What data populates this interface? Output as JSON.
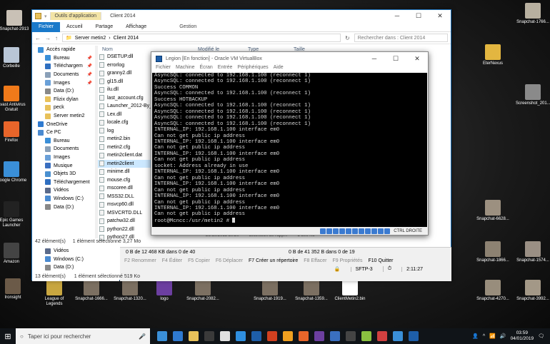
{
  "desktop": {
    "icons_left": [
      {
        "label": "Snapchat-2913",
        "color": "#c9c1b6"
      },
      {
        "label": "Corbeille",
        "color": "#b9c6d6"
      },
      {
        "label": "Avast Antivirus Gratuit",
        "color": "#f07a1a"
      },
      {
        "label": "Firefox",
        "color": "#e8652a"
      },
      {
        "label": "Google Chrome",
        "color": "#3a8fd8"
      },
      {
        "label": "Epic Games Launcher",
        "color": "#222222"
      },
      {
        "label": "Amazon",
        "color": "#444444"
      },
      {
        "label": "Ironsight",
        "color": "#6b5a48"
      }
    ],
    "icons_right": [
      {
        "label": "Snapchat-1766...",
        "color": "#b8b0a0"
      },
      {
        "label": "EterNexus",
        "color": "#e3b640"
      },
      {
        "label": "Screenshot_201...",
        "color": "#8a8a8a"
      },
      {
        "label": "Snapchat-6628...",
        "color": "#9c9080"
      },
      {
        "label": "Snapchat-1574...",
        "color": "#9a8f84"
      },
      {
        "label": "Snapchat-1866...",
        "color": "#8d8272"
      },
      {
        "label": "Snapchat-3992...",
        "color": "#a39887"
      },
      {
        "label": "Snapchat-4270...",
        "color": "#988d7c"
      }
    ],
    "icons_bottom": [
      {
        "label": "League of Legends",
        "color": "#c8a640"
      },
      {
        "label": "Snapchat-1666...",
        "color": "#7c7062"
      },
      {
        "label": "Snapchat-1320...",
        "color": "#7c7062"
      },
      {
        "label": "logo",
        "color": "#6c3fa0"
      },
      {
        "label": "Snapchat-2082...",
        "color": "#7c7062"
      },
      {
        "label": "Snapchat-1919...",
        "color": "#7c7062"
      },
      {
        "label": "Snapchat-1359...",
        "color": "#7c7062"
      },
      {
        "label": "ClientMetin2.bin",
        "color": "#ffffff"
      }
    ]
  },
  "explorer": {
    "quick_access": "▾",
    "context_tab": "Outils d'application",
    "title_path": "Client 2014",
    "ribbon": [
      "Fichier",
      "Accueil",
      "Partage",
      "Affichage"
    ],
    "ribbon_context": "Gestion",
    "address": [
      "Server metin2",
      "Client 2014"
    ],
    "search_placeholder": "Rechercher dans : Client 2014",
    "columns": {
      "name": "Nom",
      "modified": "Modifié le",
      "type": "Type",
      "size": "Taille"
    },
    "nav": [
      {
        "label": "Accès rapide",
        "color": "#3a8fd8",
        "indent": false,
        "pin": ""
      },
      {
        "label": "Bureau",
        "color": "#3a8fd8",
        "indent": true,
        "pin": "📌"
      },
      {
        "label": "Téléchargem",
        "color": "#2f6fc0",
        "indent": true,
        "pin": "📌"
      },
      {
        "label": "Documents",
        "color": "#8aa0b8",
        "indent": true,
        "pin": "📌"
      },
      {
        "label": "Images",
        "color": "#6aa0d8",
        "indent": true,
        "pin": "📌"
      },
      {
        "label": "Data (D:)",
        "color": "#888888",
        "indent": true,
        "pin": ""
      },
      {
        "label": "Flizix dylan",
        "color": "#e8c15a",
        "indent": true,
        "pin": ""
      },
      {
        "label": "peck",
        "color": "#e8c15a",
        "indent": true,
        "pin": ""
      },
      {
        "label": "Server metin2",
        "color": "#e8c15a",
        "indent": true,
        "pin": ""
      },
      {
        "label": "OneDrive",
        "color": "#2f7ad0",
        "indent": false,
        "pin": ""
      },
      {
        "label": "Ce PC",
        "color": "#4a8ad0",
        "indent": false,
        "pin": ""
      },
      {
        "label": "Bureau",
        "color": "#3a8fd8",
        "indent": true,
        "pin": ""
      },
      {
        "label": "Documents",
        "color": "#8aa0b8",
        "indent": true,
        "pin": ""
      },
      {
        "label": "Images",
        "color": "#6aa0d8",
        "indent": true,
        "pin": ""
      },
      {
        "label": "Musique",
        "color": "#3a6fc0",
        "indent": true,
        "pin": ""
      },
      {
        "label": "Objets 3D",
        "color": "#4a90d0",
        "indent": true,
        "pin": ""
      },
      {
        "label": "Téléchargement",
        "color": "#2f6fc0",
        "indent": true,
        "pin": ""
      },
      {
        "label": "Vidéos",
        "color": "#5a6a8a",
        "indent": true,
        "pin": ""
      },
      {
        "label": "Windows (C:)",
        "color": "#4a8ad0",
        "indent": true,
        "pin": ""
      },
      {
        "label": "Data (D:)",
        "color": "#888888",
        "indent": true,
        "pin": ""
      }
    ],
    "files": [
      {
        "name": "DSETUP.dll",
        "selected": false
      },
      {
        "name": "errorlog",
        "selected": false
      },
      {
        "name": "granny2.dll",
        "selected": false
      },
      {
        "name": "gl15.dll",
        "selected": false
      },
      {
        "name": "ilu.dll",
        "selected": false
      },
      {
        "name": "last_account.cfg",
        "selected": false
      },
      {
        "name": "Launcher_2012-By_do",
        "selected": false
      },
      {
        "name": "Lex.dll",
        "selected": false
      },
      {
        "name": "locale.cfg",
        "selected": false
      },
      {
        "name": "log",
        "selected": false
      },
      {
        "name": "metin2.bin",
        "selected": false
      },
      {
        "name": "metin2.cfg",
        "selected": false
      },
      {
        "name": "metin2client.dat",
        "selected": false
      },
      {
        "name": "metin2client",
        "selected": true
      },
      {
        "name": "minime.dll",
        "selected": false
      },
      {
        "name": "mouse.cfg",
        "selected": false
      },
      {
        "name": "mscoree.dll",
        "selected": false
      },
      {
        "name": "MSS32.DLL",
        "selected": false
      },
      {
        "name": "msvcp60.dll",
        "selected": false
      },
      {
        "name": "MSVCRTD.DLL",
        "selected": false
      },
      {
        "name": "patchw32.dll",
        "selected": false
      },
      {
        "name": "python22.dll",
        "selected": false
      },
      {
        "name": "python27.dll",
        "selected": false
      }
    ],
    "status_count": "42 élément(s)",
    "status_selected": "1 élément sélectionné  3,27 Mo",
    "partial_row": {
      "date": "29/10/2013 20:20",
      "type": "Extension de l'app...",
      "size": "2 300 Ko"
    }
  },
  "lower_left": {
    "items": [
      "Vidéos",
      "Windows (C:)",
      "Data (D:)"
    ],
    "status_count": "13 élément(s)",
    "status_selected": "1 élément sélectionné  519 Ko"
  },
  "ftp": {
    "left_info": "0 B de 12 468 KB dans 0 de 40",
    "right_info": "0 B de 41 352 B dans 0 de 19",
    "fkeys": [
      {
        "label": "F2 Renommer",
        "active": false
      },
      {
        "label": "F4 Éditer",
        "active": false
      },
      {
        "label": "F5 Copier",
        "active": false
      },
      {
        "label": "F6 Déplacer",
        "active": false
      },
      {
        "label": "F7 Créer un répertoire",
        "active": true
      },
      {
        "label": "F8 Effacer",
        "active": false
      },
      {
        "label": "F9 Propriétés",
        "active": false
      },
      {
        "label": "F10 Quitter",
        "active": true
      }
    ],
    "protocol": "SFTP-3",
    "time": "2:11:27"
  },
  "vbox": {
    "title": "Legion [En fonction] - Oracle VM VirtualBox",
    "menu": [
      "Fichier",
      "Machine",
      "Écran",
      "Entrée",
      "Périphériques",
      "Aide"
    ],
    "host_key": "CTRL DROITE",
    "terminal_lines": [
      "AsyncSQL: connected to 192.168.1.100 (reconnect 1)",
      "AsyncSQL: connected to 192.168.1.100 (reconnect 1)",
      "Success COMMON",
      "AsyncSQL: connected to 192.168.1.100 (reconnect 1)",
      "Success HOTBACKUP",
      "AsyncSQL: connected to 192.168.1.100 (reconnect 1)",
      "AsyncSQL: connected to 192.168.1.100 (reconnect 1)",
      "AsyncSQL: connected to 192.168.1.100 (reconnect 1)",
      "AsyncSQL: connected to 192.168.1.100 (reconnect 1)",
      "INTERNAL_IP: 192.168.1.100 interface em0",
      "Can not get public ip address",
      "INTERNAL_IP: 192.168.1.100 interface em0",
      "Can not get public ip address",
      "INTERNAL_IP: 192.168.1.100 interface em0",
      "Can not get public ip address",
      "socket: Address already in use",
      "INTERNAL_IP: 192.168.1.100 interface em0",
      "Can not get public ip address",
      "INTERNAL_IP: 192.168.1.100 interface em0",
      "Can not get public ip address",
      "INTERNAL_IP: 192.168.1.100 interface em0",
      "Can not get public ip address",
      "INTERNAL_IP: 192.168.1.100 interface em0",
      "Can not get public ip address",
      "root@Mcncc:/usr/metin2 # "
    ]
  },
  "taskbar": {
    "search_placeholder": "Taper ici pour rechercher",
    "apps": [
      "#3a8fd8",
      "#2f7ad0",
      "#e8c15a",
      "#3a3a3a",
      "#e0e0e0",
      "#2f8fe0",
      "#1e5ea8",
      "#d04020",
      "#f0a020",
      "#e8652a",
      "#6c3fa0",
      "#3a6fc0",
      "#444444",
      "#8ac040",
      "#d04040",
      "#3a8fd8",
      "#1e5ea8"
    ],
    "time": "03:59",
    "date": "04/01/2019"
  }
}
